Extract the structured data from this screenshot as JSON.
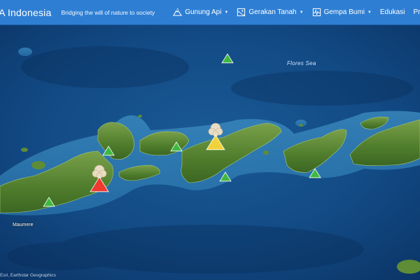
{
  "header": {
    "brand": "IA Indonesia",
    "tagline": "Bridging the will of nature to society"
  },
  "nav": {
    "items": [
      {
        "label": "Gunung Api",
        "icon": "volcano-icon",
        "dropdown": true
      },
      {
        "label": "Gerakan Tanah",
        "icon": "landslide-icon",
        "dropdown": true
      },
      {
        "label": "Gempa Bumi",
        "icon": "earthquake-icon",
        "dropdown": true
      },
      {
        "label": "Edukasi",
        "icon": "",
        "dropdown": false
      },
      {
        "label": "Press Release",
        "icon": "",
        "dropdown": false
      }
    ]
  },
  "map": {
    "sea_label": "Flores Sea",
    "city_label": "Maumere",
    "attribution": "Esri, Earthstar Geographics",
    "volcano_status_colors": {
      "normal": "#3fb83f",
      "waspada": "#f2d23a",
      "siaga": "#ee3a2f"
    },
    "volcano_markers": [
      {
        "status": "normal",
        "eruption_plume": false
      },
      {
        "status": "normal",
        "eruption_plume": false
      },
      {
        "status": "normal",
        "eruption_plume": false
      },
      {
        "status": "waspada",
        "eruption_plume": true
      },
      {
        "status": "normal",
        "eruption_plume": false
      },
      {
        "status": "siaga",
        "eruption_plume": true
      },
      {
        "status": "normal",
        "eruption_plume": false
      },
      {
        "status": "normal",
        "eruption_plume": false
      }
    ]
  }
}
